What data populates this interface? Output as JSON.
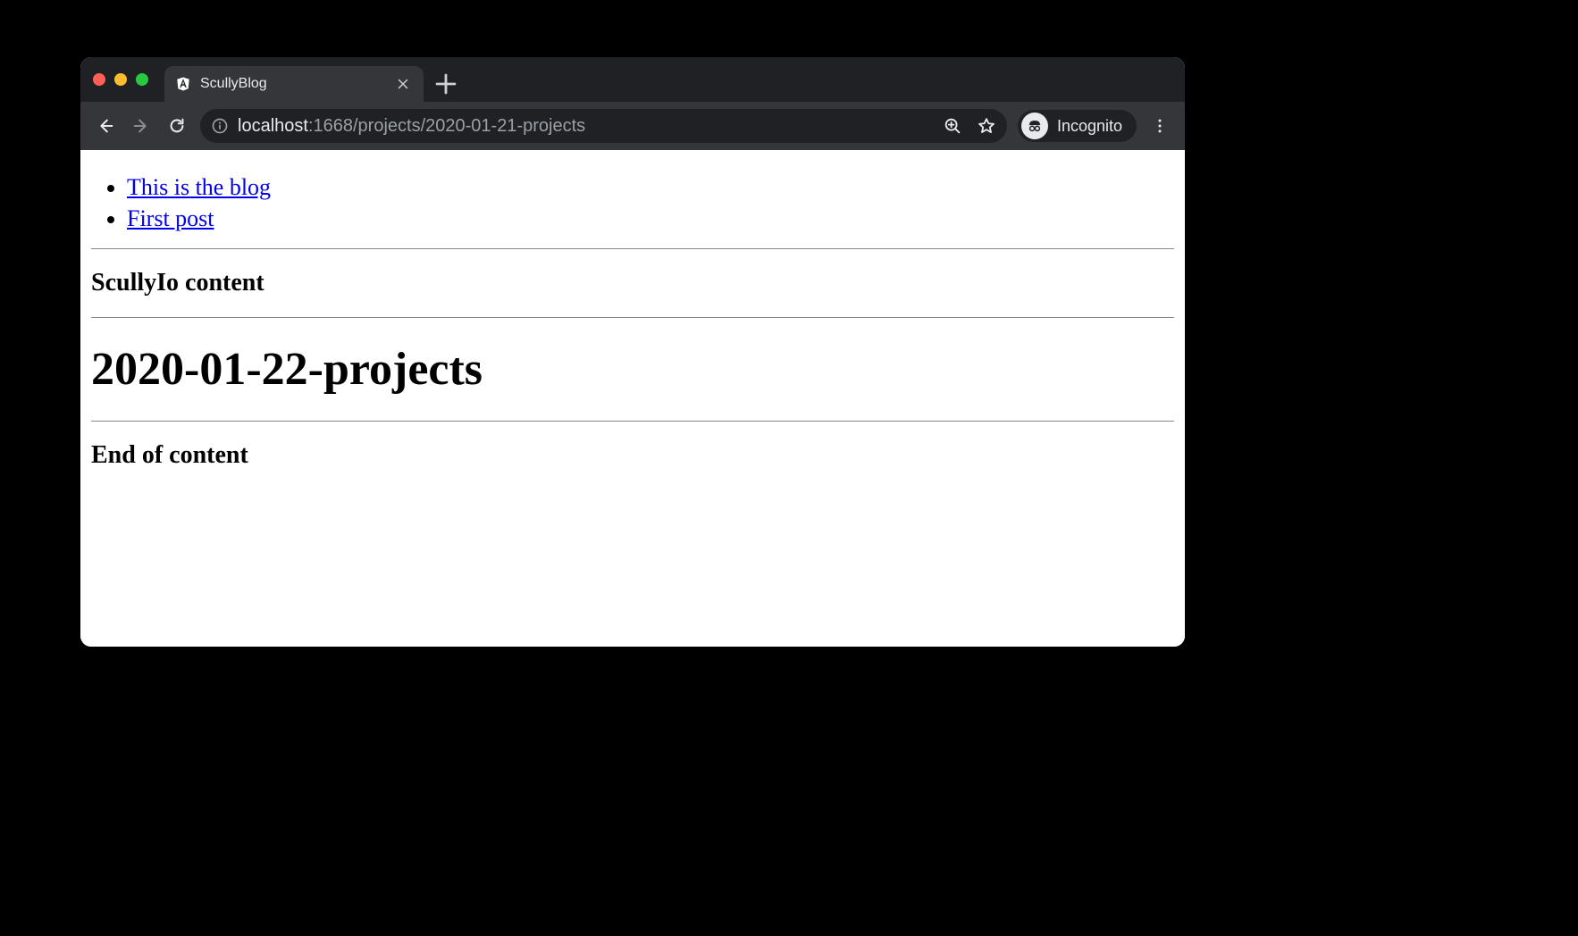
{
  "tab": {
    "title": "ScullyBlog"
  },
  "url": {
    "host": "localhost",
    "port_and_path": ":1668/projects/2020-01-21-projects"
  },
  "incognito_label": "Incognito",
  "page": {
    "links": [
      "This is the blog",
      "First post"
    ],
    "heading_a": "ScullyIo content",
    "heading_main": "2020-01-22-projects",
    "heading_b": "End of content"
  }
}
